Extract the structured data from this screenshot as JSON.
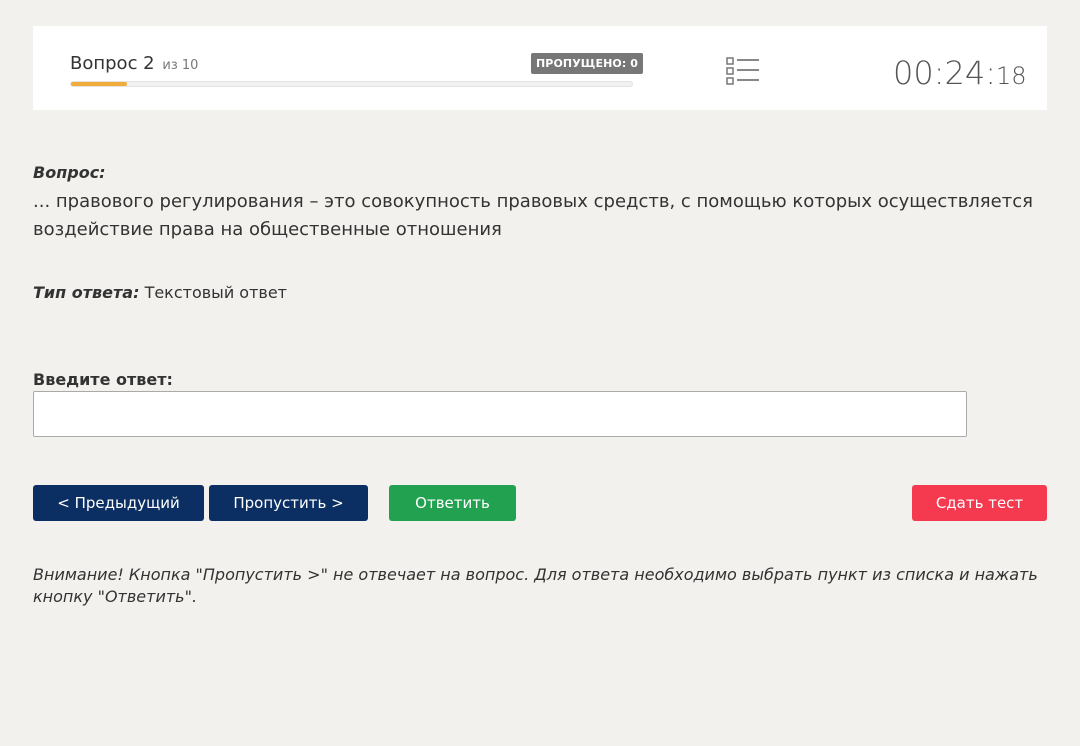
{
  "header": {
    "question_word": "Вопрос 2",
    "of_text": "из 10",
    "progress_fraction": 0.1,
    "skipped_badge": "ПРОПУЩЕНО: 0",
    "list_icon": "list-icon",
    "timer_main": "00:24:",
    "timer_seconds": "18"
  },
  "question": {
    "label": "Вопрос:",
    "text": "... правового регулирования – это совокупность правовых средств, с помощью которых осуществляется воздействие права на общественные отношения"
  },
  "answer_type": {
    "label": "Тип ответа:",
    "value": "Текстовый ответ"
  },
  "answer_input": {
    "label": "Введите ответ:",
    "value": ""
  },
  "buttons": {
    "prev": "< Предыдущий",
    "skip": "Пропустить >",
    "answer": "Ответить",
    "finish": "Сдать тест"
  },
  "notice": "Внимание! Кнопка \"Пропустить >\" не отвечает на вопрос. Для ответа необходимо выбрать пункт из списка и нажать кнопку \"Ответить\".",
  "colors": {
    "navy": "#0c2f63",
    "green": "#22a250",
    "red": "#f5394f",
    "progress": "#f0ad3c"
  }
}
